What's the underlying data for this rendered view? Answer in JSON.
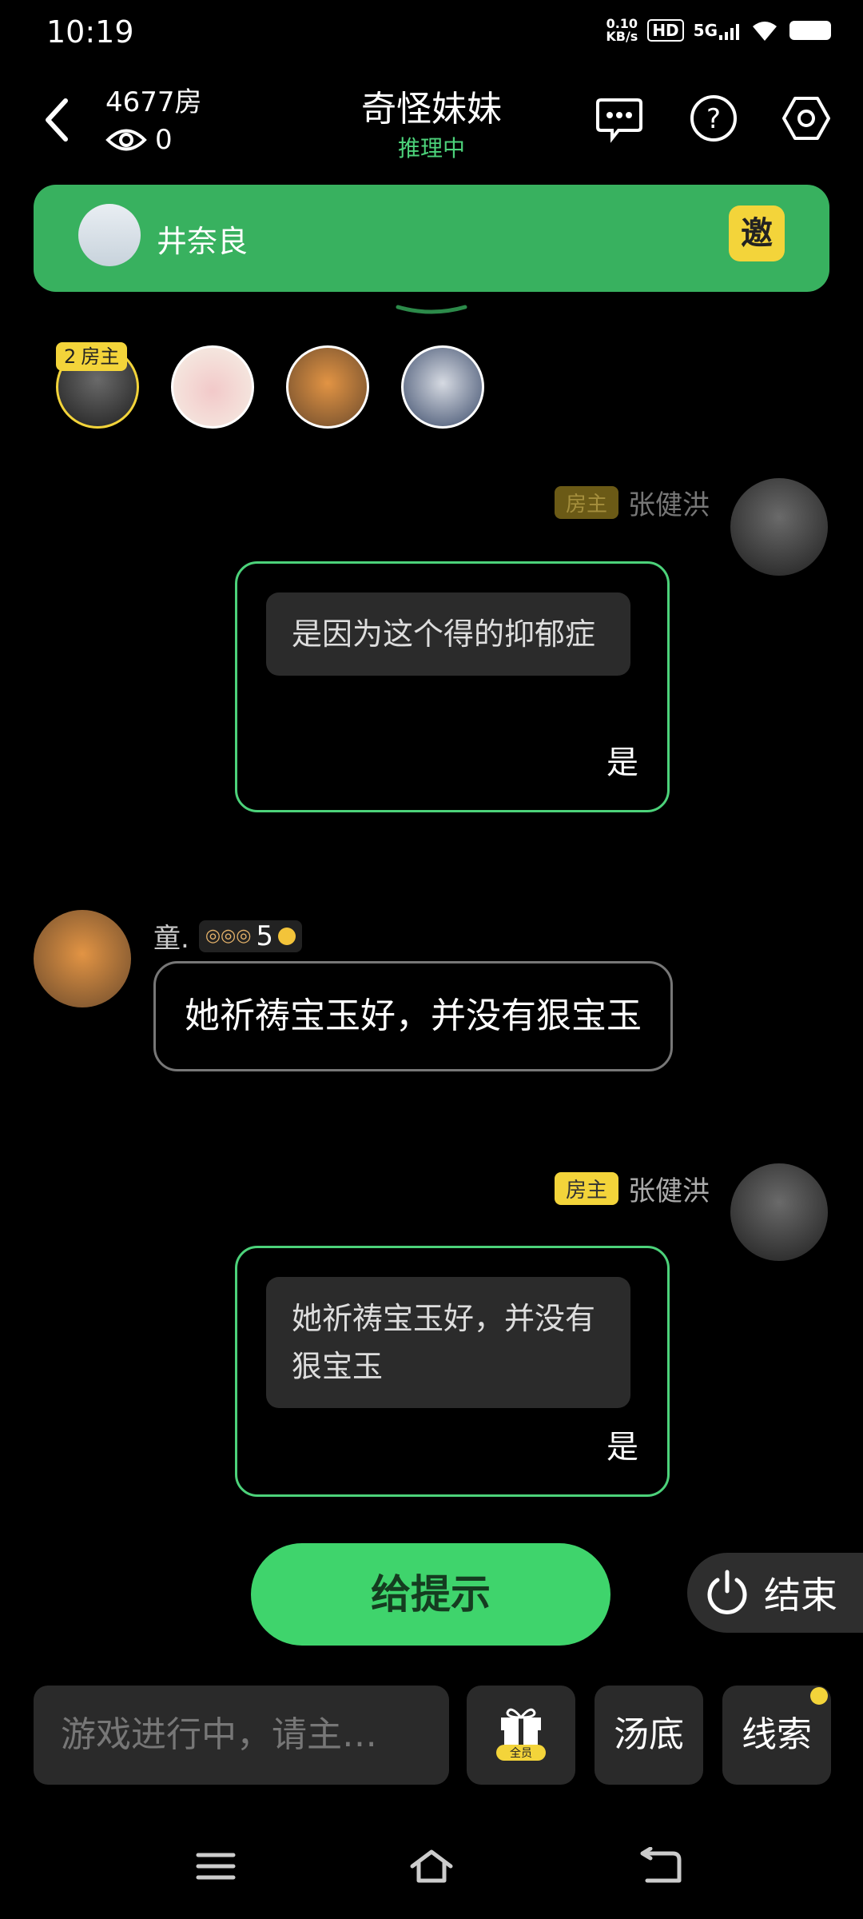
{
  "status": {
    "time": "10:19",
    "net_speed_top": "0.10",
    "net_speed_unit": "KB/s",
    "hd": "HD",
    "signal": "5G"
  },
  "header": {
    "room": "4677房",
    "viewers": "0",
    "title": "奇怪妹妹",
    "subtitle": "推理中"
  },
  "banner": {
    "name": "井奈良",
    "invite_label": "邀"
  },
  "players": {
    "host_level": "2",
    "host_tag": "房主"
  },
  "messages": [
    {
      "author": "张健洪",
      "badge": "房主",
      "quote": "是因为这个得的抑郁症",
      "answer": "是"
    },
    {
      "author": "童.",
      "level": "5",
      "text": "她祈祷宝玉好，并没有狠宝玉"
    },
    {
      "author": "张健洪",
      "badge": "房主",
      "quote": "她祈祷宝玉好，并没有狠宝玉",
      "answer": "是"
    }
  ],
  "controls": {
    "hint": "给提示",
    "end": "结束",
    "input_placeholder": "游戏进行中，请主…",
    "gift_tag": "全员",
    "soup": "汤底",
    "clue": "线索"
  },
  "colors": {
    "accent": "#3fd46c",
    "banner": "#38b15f",
    "host_badge": "#f3d43a"
  }
}
